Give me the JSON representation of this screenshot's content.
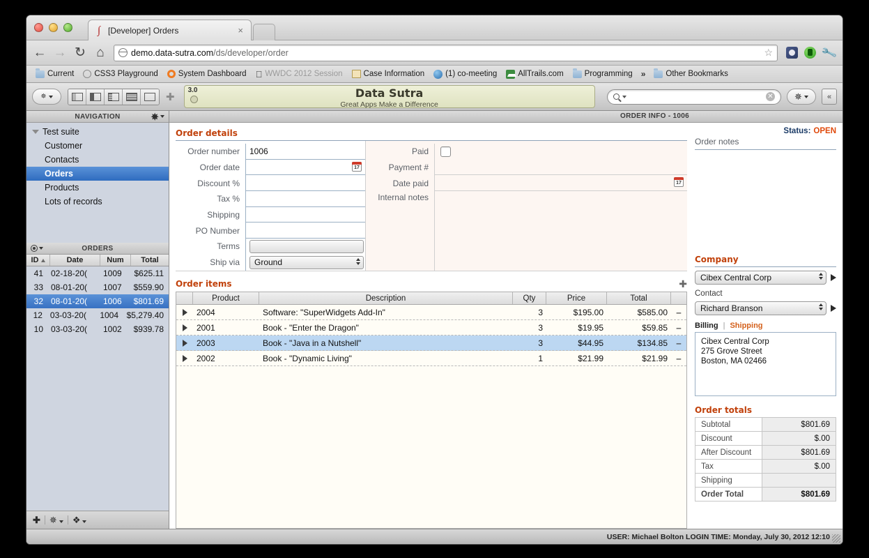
{
  "browser": {
    "tab_title": "[Developer] Orders",
    "tab_close": "×",
    "url_main": "demo.data-sutra.com",
    "url_path": "/ds/developer/order",
    "nav_back": "←",
    "nav_forward": "→",
    "nav_reload": "C",
    "nav_home": "⌂",
    "star_icon": "☆",
    "wrench_icon": "ὒ7",
    "bookmarks": [
      {
        "label": "Current",
        "icon": "folder-icon"
      },
      {
        "label": "CSS3 Playground",
        "icon": "globe-icon"
      },
      {
        "label": "System Dashboard",
        "icon": "ring-icon"
      },
      {
        "label": "WWDC 2012 Session",
        "icon": "apple-icon"
      },
      {
        "label": "Case Information",
        "icon": "document-icon"
      },
      {
        "label": "(1) co-meeting",
        "icon": "blue-globe-icon"
      },
      {
        "label": "AllTrails.com",
        "icon": "green-square-icon"
      },
      {
        "label": "Programming",
        "icon": "folder-icon"
      }
    ],
    "overflow_chevron": "»",
    "other_bookmarks": "Other Bookmarks"
  },
  "app": {
    "banner": {
      "version": "3.0",
      "title": "Data Sutra",
      "subtitle": "Great Apps Make a Difference"
    },
    "search": {
      "value": "",
      "placeholder": ""
    },
    "collapse_label": "«"
  },
  "sidebar": {
    "nav_header": "NAVIGATION",
    "nav_items": [
      {
        "label": "Test suite",
        "level": "root",
        "selected": false
      },
      {
        "label": "Customer",
        "level": "child",
        "selected": false
      },
      {
        "label": "Contacts",
        "level": "child",
        "selected": false
      },
      {
        "label": "Orders",
        "level": "child",
        "selected": true
      },
      {
        "label": "Products",
        "level": "child",
        "selected": false
      },
      {
        "label": "Lots of records",
        "level": "child",
        "selected": false
      }
    ],
    "list_header": "ORDERS",
    "columns": [
      "ID",
      "Date",
      "Num",
      "Total"
    ],
    "rows": [
      {
        "id": "41",
        "date": "02-18-20(",
        "num": "1009",
        "total": "$625.11",
        "selected": false
      },
      {
        "id": "33",
        "date": "08-01-20(",
        "num": "1007",
        "total": "$559.90",
        "selected": false
      },
      {
        "id": "32",
        "date": "08-01-20(",
        "num": "1006",
        "total": "$801.69",
        "selected": true
      },
      {
        "id": "12",
        "date": "03-03-20(",
        "num": "1004",
        "total": "$5,279.40",
        "selected": false
      },
      {
        "id": "10",
        "date": "03-03-20(",
        "num": "1002",
        "total": "$939.78",
        "selected": false
      }
    ],
    "footer_add": "✚"
  },
  "main": {
    "header_title": "ORDER INFO - 1006",
    "details_title": "Order details",
    "status_label": "Status:",
    "status_value": "OPEN",
    "fields_left": [
      {
        "label": "Order number",
        "value": "1006",
        "type": "text"
      },
      {
        "label": "Order date",
        "value": "",
        "type": "date"
      },
      {
        "label": "Discount %",
        "value": "",
        "type": "text"
      },
      {
        "label": "Tax %",
        "value": "",
        "type": "text"
      },
      {
        "label": "Shipping",
        "value": "",
        "type": "text"
      },
      {
        "label": "PO Number",
        "value": "",
        "type": "text"
      },
      {
        "label": "Terms",
        "value": "",
        "type": "select"
      },
      {
        "label": "Ship via",
        "value": "Ground",
        "type": "select"
      }
    ],
    "fields_right": [
      {
        "label": "Paid",
        "value": "",
        "type": "checkbox"
      },
      {
        "label": "Payment #",
        "value": "",
        "type": "text"
      },
      {
        "label": "Date paid",
        "value": "",
        "type": "date"
      },
      {
        "label": "Internal notes",
        "value": "",
        "type": "textarea"
      }
    ],
    "items_title": "Order items",
    "items_add": "✚",
    "items_columns": [
      "",
      "Product",
      "Description",
      "Qty",
      "Price",
      "Total"
    ],
    "items": [
      {
        "product": "2004",
        "description": "Software: \"SuperWidgets Add-In\"",
        "qty": "3",
        "price": "$195.00",
        "total": "$585.00",
        "selected": false
      },
      {
        "product": "2001",
        "description": "Book - \"Enter the Dragon\"",
        "qty": "3",
        "price": "$19.95",
        "total": "$59.85",
        "selected": false
      },
      {
        "product": "2003",
        "description": "Book - \"Java in a Nutshell\"",
        "qty": "3",
        "price": "$44.95",
        "total": "$134.85",
        "selected": true
      },
      {
        "product": "2002",
        "description": "Book - \"Dynamic Living\"",
        "qty": "1",
        "price": "$21.99",
        "total": "$21.99",
        "selected": false
      }
    ],
    "remove_glyph": "➖"
  },
  "right": {
    "notes_label": "Order notes",
    "notes_value": "",
    "company_title": "Company",
    "company_value": "Cibex Central Corp",
    "contact_label": "Contact",
    "contact_value": "Richard Branson",
    "tab_billing": "Billing",
    "tab_divider": "|",
    "tab_shipping": "Shipping",
    "address_lines": [
      "Cibex Central Corp",
      "275 Grove Street",
      "Boston, MA 02466"
    ],
    "totals_title": "Order totals",
    "totals": [
      {
        "label": "Subtotal",
        "value": "$801.69",
        "bold": false
      },
      {
        "label": "Discount",
        "value": "$.00",
        "bold": false
      },
      {
        "label": "After Discount",
        "value": "$801.69",
        "bold": false
      },
      {
        "label": "Tax",
        "value": "$.00",
        "bold": false
      },
      {
        "label": "Shipping",
        "value": "",
        "bold": false
      },
      {
        "label": "Order Total",
        "value": "$801.69",
        "bold": true
      }
    ]
  },
  "statusbar": {
    "text": "USER: Michael Bolton LOGIN TIME: Monday, July 30, 2012 12:10"
  },
  "colors": {
    "accent_orange": "#c1410b",
    "status_open": "#e04a0c",
    "selection_blue": "#3871c2",
    "row_highlight": "#bcd7f2"
  }
}
